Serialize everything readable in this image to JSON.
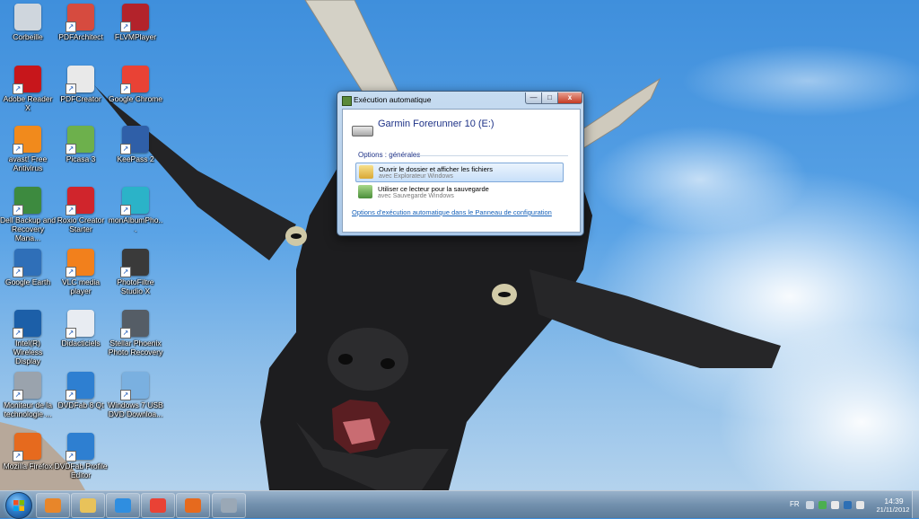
{
  "desktop": {
    "icons": [
      {
        "label": "Corbeille",
        "icon": "recycle-bin-icon",
        "color": "#cfd6dd"
      },
      {
        "label": "PDFArchitect",
        "icon": "pdf-architect-icon",
        "color": "#d64b3f"
      },
      {
        "label": "FLVMPlayer",
        "icon": "flv-player-icon",
        "color": "#b3232b"
      },
      {
        "label": "Adobe Reader X",
        "icon": "adobe-reader-icon",
        "color": "#c7161b"
      },
      {
        "label": "PDFCreator",
        "icon": "pdf-creator-icon",
        "color": "#e9e9e9"
      },
      {
        "label": "Google Chrome",
        "icon": "chrome-icon",
        "color": "#e94235"
      },
      {
        "label": "avast! Free Antivirus",
        "icon": "avast-icon",
        "color": "#f18a1c"
      },
      {
        "label": "Picasa 3",
        "icon": "picasa-icon",
        "color": "#6db04c"
      },
      {
        "label": "KeePass 2",
        "icon": "keepass-icon",
        "color": "#2f5fa8"
      },
      {
        "label": "Dell Backup and Recovery Mana...",
        "icon": "dell-backup-icon",
        "color": "#3d8a3f"
      },
      {
        "label": "Roxio Creator Starter",
        "icon": "roxio-icon",
        "color": "#d0252c"
      },
      {
        "label": "monAlbumPho...",
        "icon": "monalbum-icon",
        "color": "#2bb3c8"
      },
      {
        "label": "Google Earth",
        "icon": "google-earth-icon",
        "color": "#2f6fb8"
      },
      {
        "label": "VLC media player",
        "icon": "vlc-icon",
        "color": "#f2801c"
      },
      {
        "label": "PhotoFiltre Studio X",
        "icon": "photofiltre-icon",
        "color": "#3a3a3a"
      },
      {
        "label": "Intel(R) Wireless Display",
        "icon": "intel-wireless-display-icon",
        "color": "#1c5fa8"
      },
      {
        "label": "Didacticiels",
        "icon": "didacticiels-icon",
        "color": "#e8ecf2"
      },
      {
        "label": "Stellar Phoenix Photo Recovery",
        "icon": "stellar-phoenix-icon",
        "color": "#555d66"
      },
      {
        "label": "Moniteur de la technologie ...",
        "icon": "monitor-icon",
        "color": "#9aa3ad"
      },
      {
        "label": "DVDFab 8 Qt",
        "icon": "dvdfab-icon",
        "color": "#2e7fd1"
      },
      {
        "label": "Windows 7 USB DVD Downloa...",
        "icon": "windows-usb-icon",
        "color": "#7ab0e0"
      },
      {
        "label": "Mozilla Firefox",
        "icon": "firefox-icon",
        "color": "#e66a1e"
      },
      {
        "label": "DVDFab Profile Editor",
        "icon": "dvdfab-profile-icon",
        "color": "#2e7fd1"
      }
    ]
  },
  "autoplay": {
    "title": "Exécution automatique",
    "minimize_label": "—",
    "maximize_label": "□",
    "close_label": "x",
    "drive_name": "Garmin Forerunner 10 (E:)",
    "section_title": "Options : générales",
    "options": [
      {
        "main": "Ouvrir le dossier et afficher les fichiers",
        "sub": "avec Explorateur Windows"
      },
      {
        "main": "Utiliser ce lecteur pour la sauvegarde",
        "sub": "avec Sauvegarde Windows"
      }
    ],
    "config_link": "Options d'exécution automatique dans le Panneau de configuration"
  },
  "taskbar": {
    "pinned": [
      {
        "name": "media-player-icon",
        "color": "#e8862a"
      },
      {
        "name": "explorer-folder-icon",
        "color": "#e8c25a"
      },
      {
        "name": "internet-explorer-icon",
        "color": "#2f8ee0"
      },
      {
        "name": "chrome-icon",
        "color": "#e94235"
      },
      {
        "name": "firefox-icon",
        "color": "#e66a1e"
      },
      {
        "name": "autoplay-task-icon",
        "color": "#9aa8b6"
      }
    ],
    "language": "FR",
    "time": "14:39",
    "date": "21/11/2012"
  }
}
